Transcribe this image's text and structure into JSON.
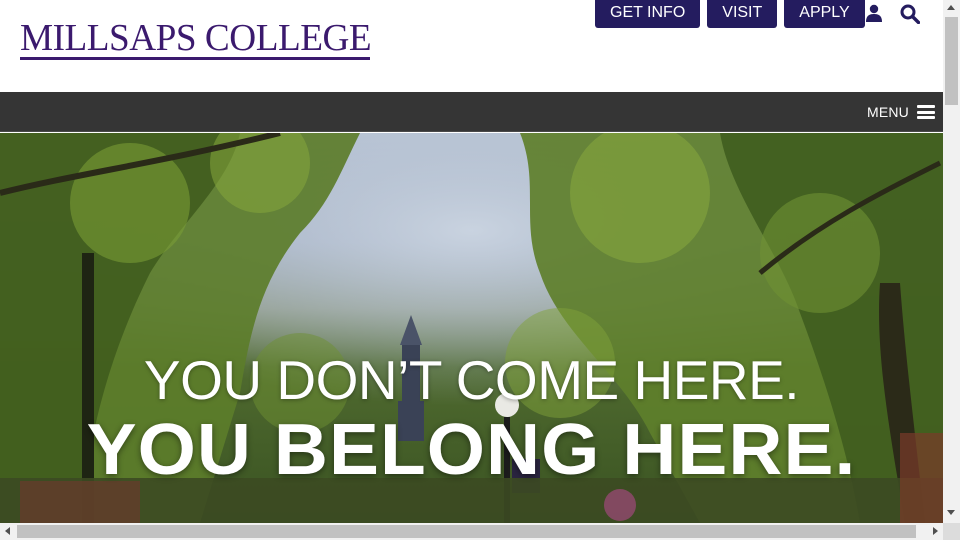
{
  "brand": {
    "name": "MILLSAPS COLLEGE",
    "color": "#3b1a6e"
  },
  "top_actions": [
    {
      "label": "GET INFO"
    },
    {
      "label": "VISIT"
    },
    {
      "label": "APPLY"
    }
  ],
  "top_icons": {
    "account": "user-icon",
    "search": "search-icon"
  },
  "nav": {
    "menu_label": "MENU",
    "menu_icon": "hamburger-icon",
    "background": "#353535"
  },
  "hero": {
    "line1": "YOU DON’T COME HERE.",
    "line2": "YOU BELONG HERE."
  },
  "colors": {
    "button_bg": "#241c5f",
    "button_text": "#ffffff"
  }
}
